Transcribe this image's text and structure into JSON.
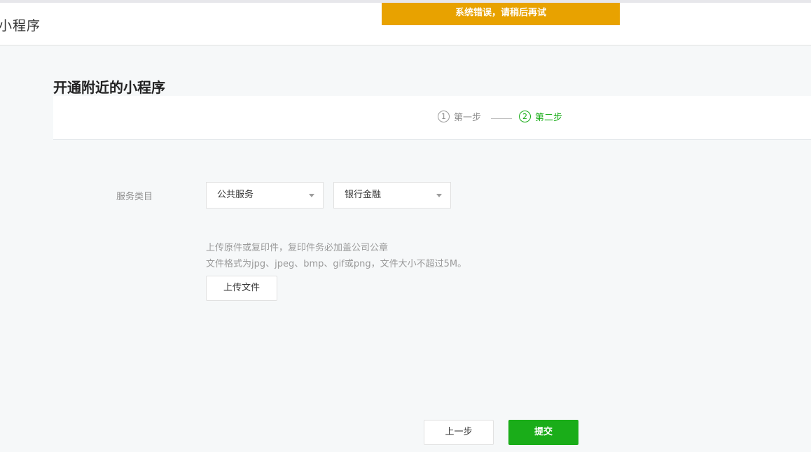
{
  "header": {
    "app_title": "小程序",
    "error_message": "系统错误，请稍后再试"
  },
  "page": {
    "heading": "开通附近的小程序"
  },
  "steps": [
    {
      "number": "1",
      "label": "第一步",
      "active": false
    },
    {
      "number": "2",
      "label": "第二步",
      "active": true
    }
  ],
  "form": {
    "service_category_label": "服务类目",
    "category_primary": "公共服务",
    "category_secondary": "银行金融",
    "upload_tip_line1": "上传原件或复印件，复印件务必加盖公司公章",
    "upload_tip_line2": "文件格式为jpg、jpeg、bmp、gif或png，文件大小不超过5M。",
    "upload_button": "上传文件"
  },
  "actions": {
    "prev_label": "上一步",
    "submit_label": "提交"
  },
  "colors": {
    "brand_green": "#1aad19",
    "error_orange": "#e8a200"
  }
}
